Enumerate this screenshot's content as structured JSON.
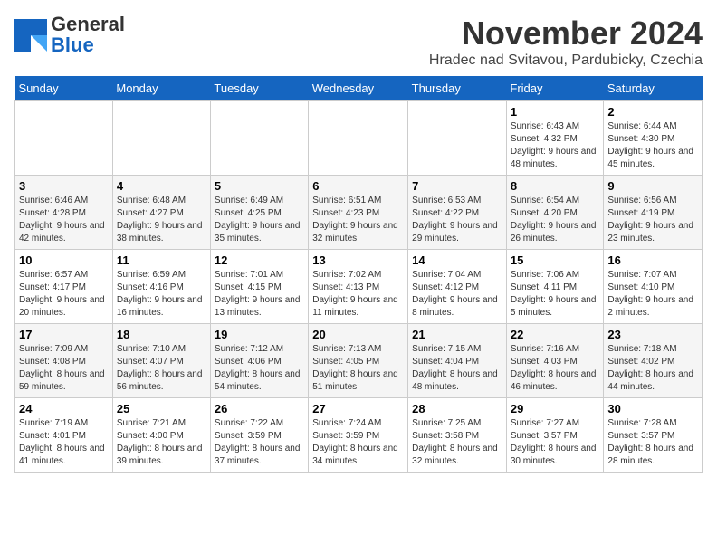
{
  "logo": {
    "general": "General",
    "blue": "Blue"
  },
  "title": "November 2024",
  "location": "Hradec nad Svitavou, Pardubicky, Czechia",
  "weekdays": [
    "Sunday",
    "Monday",
    "Tuesday",
    "Wednesday",
    "Thursday",
    "Friday",
    "Saturday"
  ],
  "weeks": [
    [
      {
        "day": "",
        "info": ""
      },
      {
        "day": "",
        "info": ""
      },
      {
        "day": "",
        "info": ""
      },
      {
        "day": "",
        "info": ""
      },
      {
        "day": "",
        "info": ""
      },
      {
        "day": "1",
        "info": "Sunrise: 6:43 AM\nSunset: 4:32 PM\nDaylight: 9 hours and 48 minutes."
      },
      {
        "day": "2",
        "info": "Sunrise: 6:44 AM\nSunset: 4:30 PM\nDaylight: 9 hours and 45 minutes."
      }
    ],
    [
      {
        "day": "3",
        "info": "Sunrise: 6:46 AM\nSunset: 4:28 PM\nDaylight: 9 hours and 42 minutes."
      },
      {
        "day": "4",
        "info": "Sunrise: 6:48 AM\nSunset: 4:27 PM\nDaylight: 9 hours and 38 minutes."
      },
      {
        "day": "5",
        "info": "Sunrise: 6:49 AM\nSunset: 4:25 PM\nDaylight: 9 hours and 35 minutes."
      },
      {
        "day": "6",
        "info": "Sunrise: 6:51 AM\nSunset: 4:23 PM\nDaylight: 9 hours and 32 minutes."
      },
      {
        "day": "7",
        "info": "Sunrise: 6:53 AM\nSunset: 4:22 PM\nDaylight: 9 hours and 29 minutes."
      },
      {
        "day": "8",
        "info": "Sunrise: 6:54 AM\nSunset: 4:20 PM\nDaylight: 9 hours and 26 minutes."
      },
      {
        "day": "9",
        "info": "Sunrise: 6:56 AM\nSunset: 4:19 PM\nDaylight: 9 hours and 23 minutes."
      }
    ],
    [
      {
        "day": "10",
        "info": "Sunrise: 6:57 AM\nSunset: 4:17 PM\nDaylight: 9 hours and 20 minutes."
      },
      {
        "day": "11",
        "info": "Sunrise: 6:59 AM\nSunset: 4:16 PM\nDaylight: 9 hours and 16 minutes."
      },
      {
        "day": "12",
        "info": "Sunrise: 7:01 AM\nSunset: 4:15 PM\nDaylight: 9 hours and 13 minutes."
      },
      {
        "day": "13",
        "info": "Sunrise: 7:02 AM\nSunset: 4:13 PM\nDaylight: 9 hours and 11 minutes."
      },
      {
        "day": "14",
        "info": "Sunrise: 7:04 AM\nSunset: 4:12 PM\nDaylight: 9 hours and 8 minutes."
      },
      {
        "day": "15",
        "info": "Sunrise: 7:06 AM\nSunset: 4:11 PM\nDaylight: 9 hours and 5 minutes."
      },
      {
        "day": "16",
        "info": "Sunrise: 7:07 AM\nSunset: 4:10 PM\nDaylight: 9 hours and 2 minutes."
      }
    ],
    [
      {
        "day": "17",
        "info": "Sunrise: 7:09 AM\nSunset: 4:08 PM\nDaylight: 8 hours and 59 minutes."
      },
      {
        "day": "18",
        "info": "Sunrise: 7:10 AM\nSunset: 4:07 PM\nDaylight: 8 hours and 56 minutes."
      },
      {
        "day": "19",
        "info": "Sunrise: 7:12 AM\nSunset: 4:06 PM\nDaylight: 8 hours and 54 minutes."
      },
      {
        "day": "20",
        "info": "Sunrise: 7:13 AM\nSunset: 4:05 PM\nDaylight: 8 hours and 51 minutes."
      },
      {
        "day": "21",
        "info": "Sunrise: 7:15 AM\nSunset: 4:04 PM\nDaylight: 8 hours and 48 minutes."
      },
      {
        "day": "22",
        "info": "Sunrise: 7:16 AM\nSunset: 4:03 PM\nDaylight: 8 hours and 46 minutes."
      },
      {
        "day": "23",
        "info": "Sunrise: 7:18 AM\nSunset: 4:02 PM\nDaylight: 8 hours and 44 minutes."
      }
    ],
    [
      {
        "day": "24",
        "info": "Sunrise: 7:19 AM\nSunset: 4:01 PM\nDaylight: 8 hours and 41 minutes."
      },
      {
        "day": "25",
        "info": "Sunrise: 7:21 AM\nSunset: 4:00 PM\nDaylight: 8 hours and 39 minutes."
      },
      {
        "day": "26",
        "info": "Sunrise: 7:22 AM\nSunset: 3:59 PM\nDaylight: 8 hours and 37 minutes."
      },
      {
        "day": "27",
        "info": "Sunrise: 7:24 AM\nSunset: 3:59 PM\nDaylight: 8 hours and 34 minutes."
      },
      {
        "day": "28",
        "info": "Sunrise: 7:25 AM\nSunset: 3:58 PM\nDaylight: 8 hours and 32 minutes."
      },
      {
        "day": "29",
        "info": "Sunrise: 7:27 AM\nSunset: 3:57 PM\nDaylight: 8 hours and 30 minutes."
      },
      {
        "day": "30",
        "info": "Sunrise: 7:28 AM\nSunset: 3:57 PM\nDaylight: 8 hours and 28 minutes."
      }
    ]
  ]
}
